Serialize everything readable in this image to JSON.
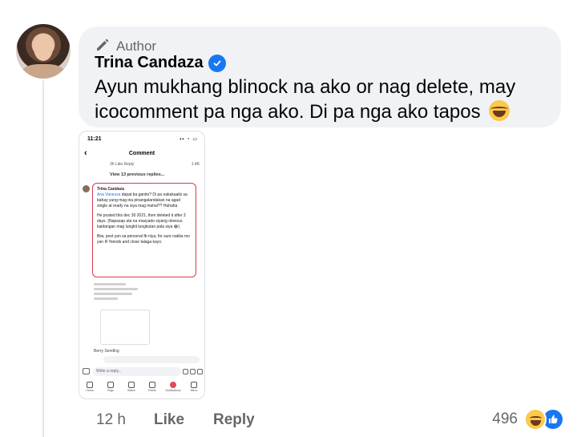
{
  "comment": {
    "badge": "Author",
    "author_name": "Trina Candaza",
    "text": "Ayun mukhang blinock na ako or nag delete, may icocomment pa nga ako. Di pa nga ako tapos",
    "time": "12 h",
    "like_label": "Like",
    "reply_label": "Reply",
    "reaction_count": "496",
    "reaction_icons": [
      "haha-icon",
      "like-icon"
    ]
  },
  "phone": {
    "status_time": "11:21",
    "title": "Comment",
    "prev_row": "3h   Like   Reply",
    "prev_reacts": "1.4K",
    "view_previous": "View 13 previous replies...",
    "card_name": "Trina Candaza",
    "mention": "Ana Vanessa",
    "para1": " dapat ba ganito? Di pa nakakaalis sa bahay yung mag ina pinangalandakan na agad single at ready na siya mag mahal?? Hahaha",
    "para2": "He posted this dec 30 2021, then deleted it after 3 days. (Napasap ata na masyado siyang obvious kaidangan mag lungkit lungkutan pala siya 😂)",
    "para3": "Btw, post yan sa personal fb niya, for sure nakita mo yan IF friends and close talaga kayo.",
    "berry": "Berry Sendlng",
    "input_placeholder": "Write a reply...",
    "tabs": [
      "Home",
      "Page",
      "Watch",
      "Feeds",
      "Notifications",
      "Menu"
    ]
  },
  "colors": {
    "accent": "#1877f2",
    "bubble": "#f0f2f5",
    "secondary_text": "#65676b",
    "highlight_border": "#d93b4c"
  }
}
